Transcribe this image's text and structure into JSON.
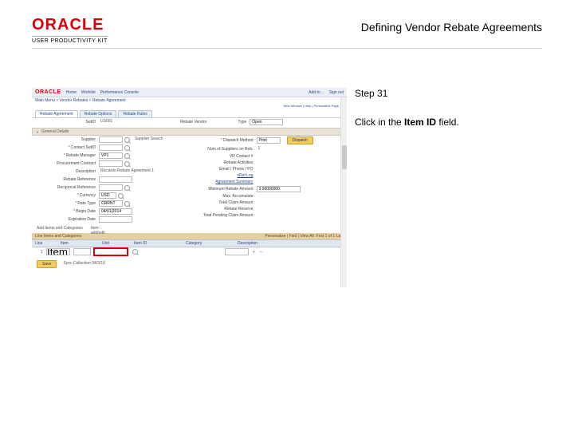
{
  "header": {
    "brand": "ORACLE",
    "brand_sub": "USER PRODUCTIVITY KIT",
    "title": "Defining Vendor Rebate Agreements"
  },
  "side": {
    "step_label": "Step 31",
    "instr_pre": "Click in the ",
    "instr_field": "Item ID",
    "instr_post": " field."
  },
  "ms": {
    "brand": "ORACLE",
    "topnav": [
      "Home",
      "Worklist",
      "Performance Console",
      "Add to…",
      "Sign out"
    ],
    "breadcrumb": "Main Menu  >  Vendor Rebates  >  Rebate Agreement",
    "page_hint": "New Window | Help | Personalize Page",
    "tabs": [
      "Rebate Agreement",
      "Rebate Options",
      "Rebate Rules"
    ],
    "band": {
      "setid_lbl": "SetID",
      "setid_val": "US001",
      "vendor_lbl": "Rebate Vendor",
      "type_lbl": "Type",
      "type_val": "Open"
    },
    "gen_hdr": "General Details",
    "left": {
      "supplier_lbl": "Supplier",
      "supplier_btn": "Supplier Search",
      "contact_lbl": "Contact SetID",
      "rebate_mgr_lbl": "Rebate Manager",
      "rebate_mgr_val": "VP1",
      "proc_contract_lbl": "Procurement Contract",
      "descr_lbl": "Description",
      "descr_val": "Riccardo Rebate Agreement 1",
      "ref_lbl": "Rebate Reference",
      "reciprocal_lbl": "Reciprocal Reference",
      "currency_lbl": "Currency",
      "currency_val": "USD",
      "rate_type_lbl": "Rate Type",
      "rate_type_val": "CRRNT",
      "begin_lbl": "Begin Date",
      "begin_val": "04/01/2014",
      "exp_lbl": "Expiration Date"
    },
    "right": {
      "dispatch_lbl": "Dispatch Method",
      "dispatch_val": "Print",
      "dispatch_btn": "Dispatch",
      "num_suppliers_lbl": "Num of Suppliers on Reb.",
      "num_suppliers_val": "1",
      "contact_lbl": "VR Contact #",
      "activities_lbl": "Rebate Activities",
      "email_lbl": "Email / Phone / PO",
      "xref_lbl": "xRef Log",
      "summary_hdr": "Agreement Summary",
      "min_lbl": "Minimum Rebate Amount",
      "min_val": "0.00000000",
      "max_lbl": "Max. Accumulate",
      "claim_lbl": "Total Claim Amount",
      "reserve_lbl": "Rebate Reserve",
      "pending_lbl": "Total Pending Claim Amount"
    },
    "grid": {
      "section_lbl": "Add Items and Categories",
      "sub_hdr": "Line Items and Categories",
      "find_lbl": "Personalize | Find | View All",
      "counter": "First   1 of 1   Last",
      "cols": {
        "line": "Line",
        "item": "Item",
        "unit": "Unit",
        "itemid": "Item ID",
        "category": "Category",
        "description": "Description"
      },
      "row1": {
        "line_val": "1",
        "item_val": "Item"
      }
    },
    "footer": {
      "save_btn": "Save",
      "sync_lbl": "Sync Collection 04/3/10"
    }
  }
}
